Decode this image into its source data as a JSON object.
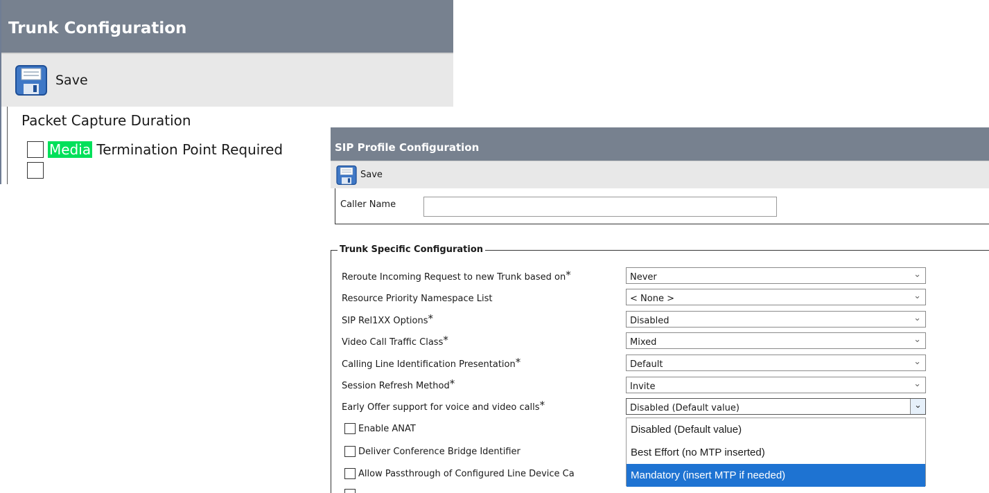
{
  "trunk": {
    "title": "Trunk Configuration",
    "save_label": "Save",
    "packet_capture_label": "Packet Capture Duration",
    "mtp_label_highlight": "Media",
    "mtp_label_rest": " Termination Point Required",
    "mtp_checked": false
  },
  "sip": {
    "title": "SIP Profile Configuration",
    "save_label": "Save",
    "caller_name_label": "Caller Name",
    "caller_name_value": "",
    "section_title": "Trunk Specific Configuration",
    "fields": [
      {
        "label": "Reroute Incoming Request to new Trunk based on",
        "required": "*",
        "value": "Never"
      },
      {
        "label": "Resource Priority Namespace List",
        "required": "",
        "value": "< None >"
      },
      {
        "label": "SIP Rel1XX Options",
        "required": "*",
        "value": "Disabled"
      },
      {
        "label": "Video Call Traffic Class",
        "required": "*",
        "value": "Mixed"
      },
      {
        "label": "Calling Line Identification Presentation",
        "required": "*",
        "value": "Default"
      },
      {
        "label": "Session Refresh Method",
        "required": "*",
        "value": "Invite"
      },
      {
        "label": "Early Offer support for voice and video calls",
        "required": "*",
        "value": "Disabled (Default value)"
      }
    ],
    "early_offer_options": [
      {
        "label": "Disabled (Default value)",
        "selected": false
      },
      {
        "label": "Best Effort (no MTP inserted)",
        "selected": false
      },
      {
        "label": "Mandatory (insert MTP if needed)",
        "selected": true
      }
    ],
    "checkboxes": [
      {
        "label": "Enable ANAT",
        "checked": false
      },
      {
        "label": "Deliver Conference Bridge Identifier",
        "checked": false
      },
      {
        "label": "Allow Passthrough of Configured Line Device Ca",
        "checked": false
      }
    ]
  },
  "colors": {
    "title_bar": "#77818f",
    "toolbar": "#e8e8e8",
    "highlight": "#00e05a",
    "selected_option": "#1e73d2"
  }
}
